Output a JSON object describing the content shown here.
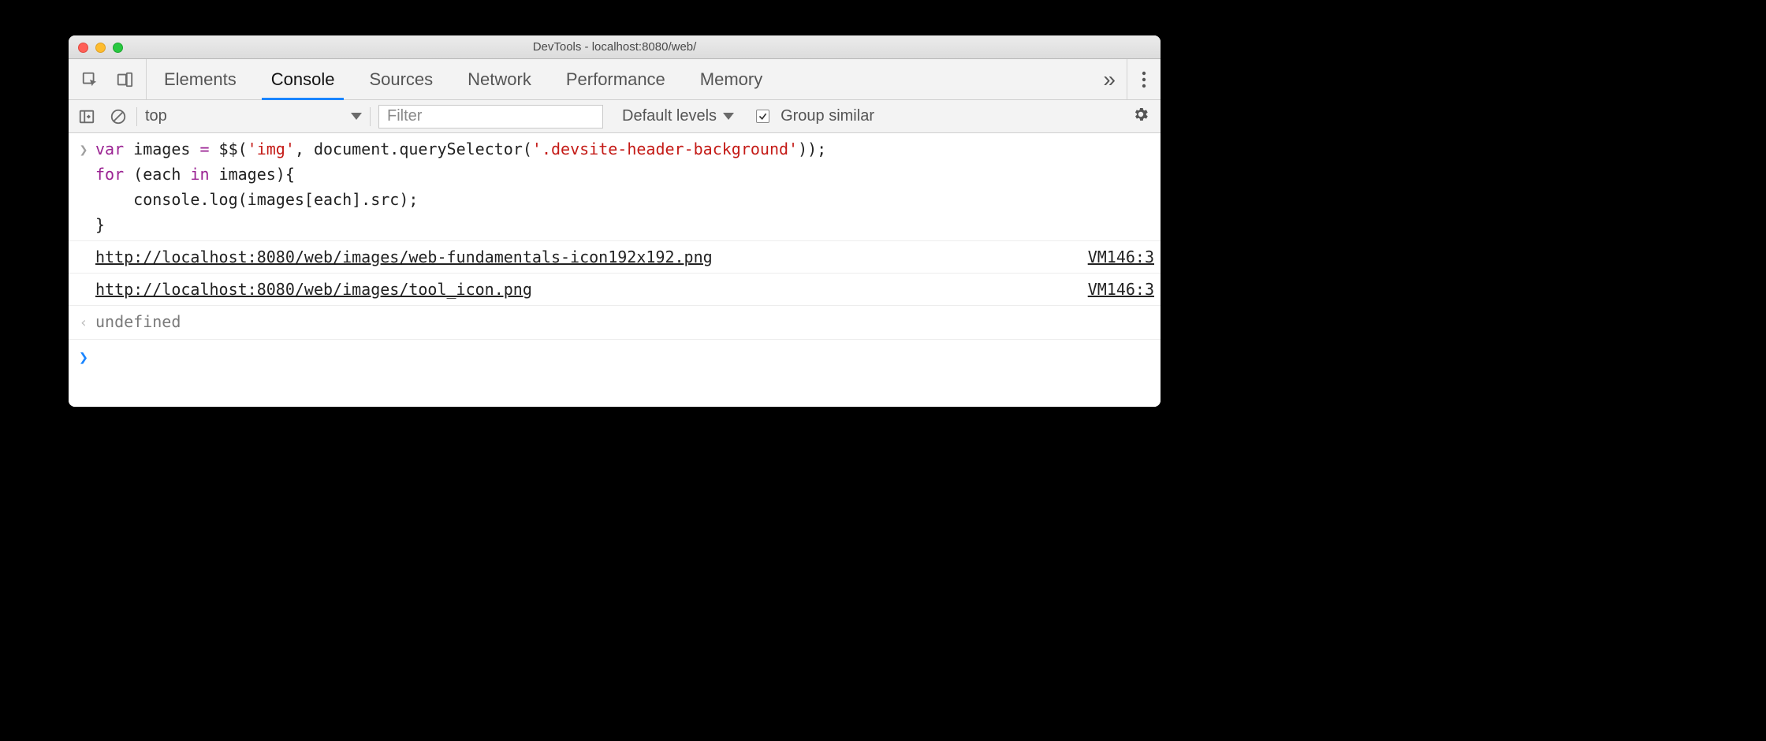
{
  "window": {
    "title": "DevTools - localhost:8080/web/"
  },
  "tabs": {
    "items": [
      "Elements",
      "Console",
      "Sources",
      "Network",
      "Performance",
      "Memory"
    ],
    "active_index": 1,
    "overflow_glyph": "»"
  },
  "console_toolbar": {
    "context": "top",
    "filter_placeholder": "Filter",
    "filter_value": "",
    "levels_label": "Default levels",
    "group_similar_checked": true,
    "group_similar_label": "Group similar"
  },
  "console": {
    "input_code": {
      "tokens": [
        {
          "t": "kw",
          "v": "var"
        },
        {
          "t": "plain",
          "v": " images "
        },
        {
          "t": "kw",
          "v": "="
        },
        {
          "t": "plain",
          "v": " $$("
        },
        {
          "t": "str",
          "v": "'img'"
        },
        {
          "t": "plain",
          "v": ", document.querySelector("
        },
        {
          "t": "str",
          "v": "'.devsite-header-background'"
        },
        {
          "t": "plain",
          "v": "));\n"
        },
        {
          "t": "kw",
          "v": "for"
        },
        {
          "t": "plain",
          "v": " (each "
        },
        {
          "t": "kw",
          "v": "in"
        },
        {
          "t": "plain",
          "v": " images){\n    console.log(images[each].src);\n}"
        }
      ]
    },
    "logs": [
      {
        "text": "http://localhost:8080/web/images/web-fundamentals-icon192x192.png",
        "source": "VM146:3"
      },
      {
        "text": "http://localhost:8080/web/images/tool_icon.png",
        "source": "VM146:3"
      }
    ],
    "return_value": "undefined",
    "prompt_glyph": "›"
  }
}
